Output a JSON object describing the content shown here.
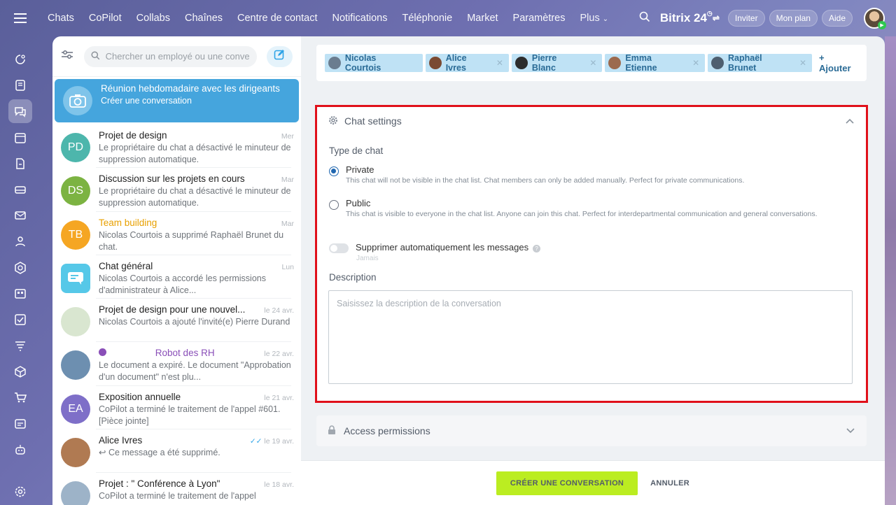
{
  "topbar": {
    "nav": [
      "Chats",
      "CoPilot",
      "Collabs",
      "Chaînes",
      "Centre de contact",
      "Notifications",
      "Téléphonie",
      "Market",
      "Paramètres",
      "Plus"
    ],
    "brand": "Bitrix 24",
    "buttons": {
      "invite": "Inviter",
      "plan": "Mon plan",
      "help": "Aide"
    }
  },
  "leftnav": {
    "icons": [
      "menu-icon",
      "activity-icon",
      "feed-icon",
      "chat-icon",
      "calendar-icon",
      "docs-icon",
      "drive-icon",
      "mail-icon",
      "contacts-icon",
      "crm-icon",
      "sites-icon",
      "tasks-icon",
      "filter-icon",
      "box-icon",
      "cart-icon",
      "id-card-icon",
      "robot-icon",
      "settings-icon"
    ]
  },
  "chatlist": {
    "search_placeholder": "Chercher un employé ou une conve",
    "items": [
      {
        "title": "Réunion hebdomadaire avec les dirigeants",
        "sub": "Créer une conversation",
        "date": "",
        "avatar": "",
        "color": "#7fc4ea",
        "highlight": true
      },
      {
        "title": "Projet de design",
        "sub": "Le propriétaire du chat a désactivé le minuteur de suppression automatique.",
        "date": "Mer",
        "avatar": "PD",
        "color": "#4db6ac"
      },
      {
        "title": "Discussion sur les projets en cours",
        "sub": "Le propriétaire du chat a désactivé le minuteur de suppression automatique.",
        "date": "Mar",
        "avatar": "DS",
        "color": "#7cb342"
      },
      {
        "title": "Team building",
        "sub": "Nicolas Courtois a supprimé Raphaël Brunet du chat.",
        "date": "Mar",
        "avatar": "TB",
        "color": "#f5a623",
        "titleColor": "#e8a000"
      },
      {
        "title": "Chat général",
        "sub": "Nicolas Courtois a accordé les permissions d'administrateur à Alice...",
        "date": "Lun",
        "avatar": "",
        "color": "#56c8e8"
      },
      {
        "title": "Projet de design pour une nouvel...",
        "sub": "Nicolas Courtois a ajouté l'invité(e) Pierre Durand",
        "date": "le 24 avr.",
        "avatar": "",
        "color": "#d9e6d0"
      },
      {
        "title": "Robot des RH",
        "sub": "Le document a expiré. Le document \"Approbation d'un document\" n'est plu...",
        "date": "le 22 avr.",
        "avatar": "",
        "color": "#6d8fb0",
        "titleColor": "#8a4fb8"
      },
      {
        "title": "Exposition annuelle",
        "sub": "CoPilot a terminé le traitement de l'appel #601. [Pièce jointe]",
        "date": "le 21 avr.",
        "avatar": "EA",
        "color": "#7e6fc8"
      },
      {
        "title": "Alice Ivres",
        "sub": "↩ Ce message a été supprimé.",
        "date": "le 19 avr.",
        "avatar": "",
        "color": "#b07a52"
      },
      {
        "title": "Projet : \" Conférence à Lyon\"",
        "sub": "CoPilot a terminé le traitement de l'appel",
        "date": "le 18 avr.",
        "avatar": "",
        "color": "#9db3c8"
      }
    ]
  },
  "members": {
    "chips": [
      "Nicolas Courtois",
      "Alice Ivres",
      "Pierre Blanc",
      "Emma Etienne",
      "Raphaël Brunet"
    ],
    "add_label": "+ Ajouter"
  },
  "settings": {
    "header": "Chat settings",
    "type_label": "Type de chat",
    "private_title": "Private",
    "private_desc": "This chat will not be visible in the chat list. Chat members can only be added manually. Perfect for private communications.",
    "public_title": "Public",
    "public_desc": "This chat is visible to everyone in the chat list. Anyone can join this chat. Perfect for interdepartmental communication and general conversations.",
    "autodelete_label": "Supprimer automatiquement les messages",
    "autodelete_value": "Jamais",
    "description_label": "Description",
    "description_placeholder": "Saisissez la description de la conversation"
  },
  "access": {
    "label": "Access permissions"
  },
  "footer": {
    "create": "CRÉER UNE CONVERSATION",
    "cancel": "ANNULER"
  }
}
